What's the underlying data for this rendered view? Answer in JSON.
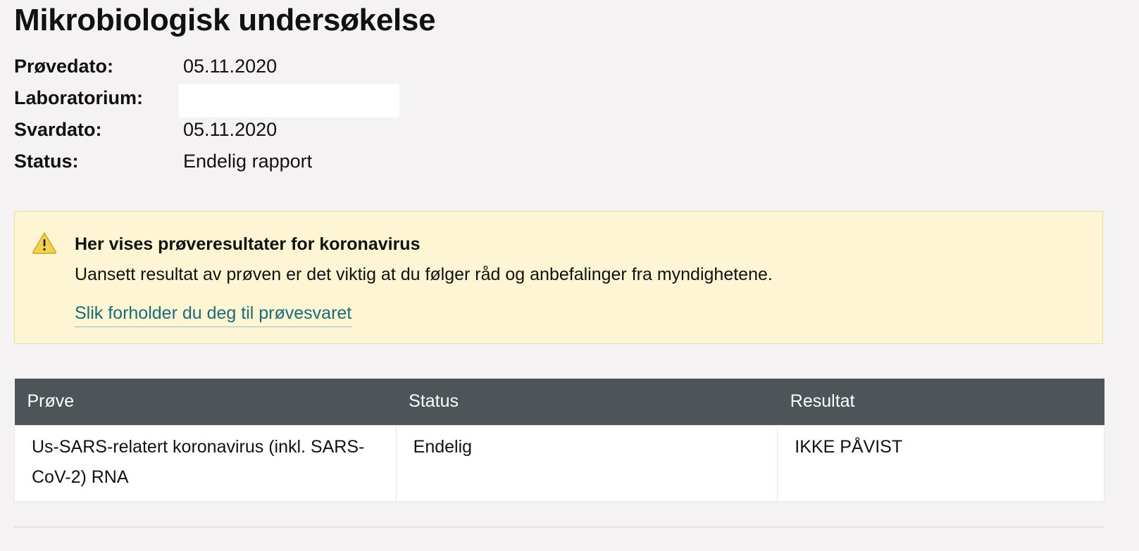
{
  "page": {
    "title": "Mikrobiologisk undersøkelse"
  },
  "meta": {
    "provedato_label": "Prøvedato:",
    "provedato_value": "05.11.2020",
    "laboratorium_label": "Laboratorium:",
    "laboratorium_value": "",
    "svardato_label": "Svardato:",
    "svardato_value": "05.11.2020",
    "status_label": "Status:",
    "status_value": "Endelig rapport"
  },
  "alert": {
    "icon": "warning-triangle-icon",
    "heading": "Her vises prøveresultater for koronavirus",
    "text": "Uansett resultat av prøven er det viktig at du følger råd og anbefalinger fra myndighetene.",
    "link": "Slik forholder du deg til prøvesvaret",
    "background_color": "#fdf5d3",
    "border_color": "#ecdc9e",
    "link_color": "#1d6a78"
  },
  "table": {
    "header_color": "#4e5558",
    "columns": [
      "Prøve",
      "Status",
      "Resultat"
    ],
    "rows": [
      {
        "prove": "Us-SARS-relatert koronavirus (inkl. SARS-CoV-2) RNA",
        "status": "Endelig",
        "resultat": "IKKE PÅVIST"
      }
    ]
  }
}
